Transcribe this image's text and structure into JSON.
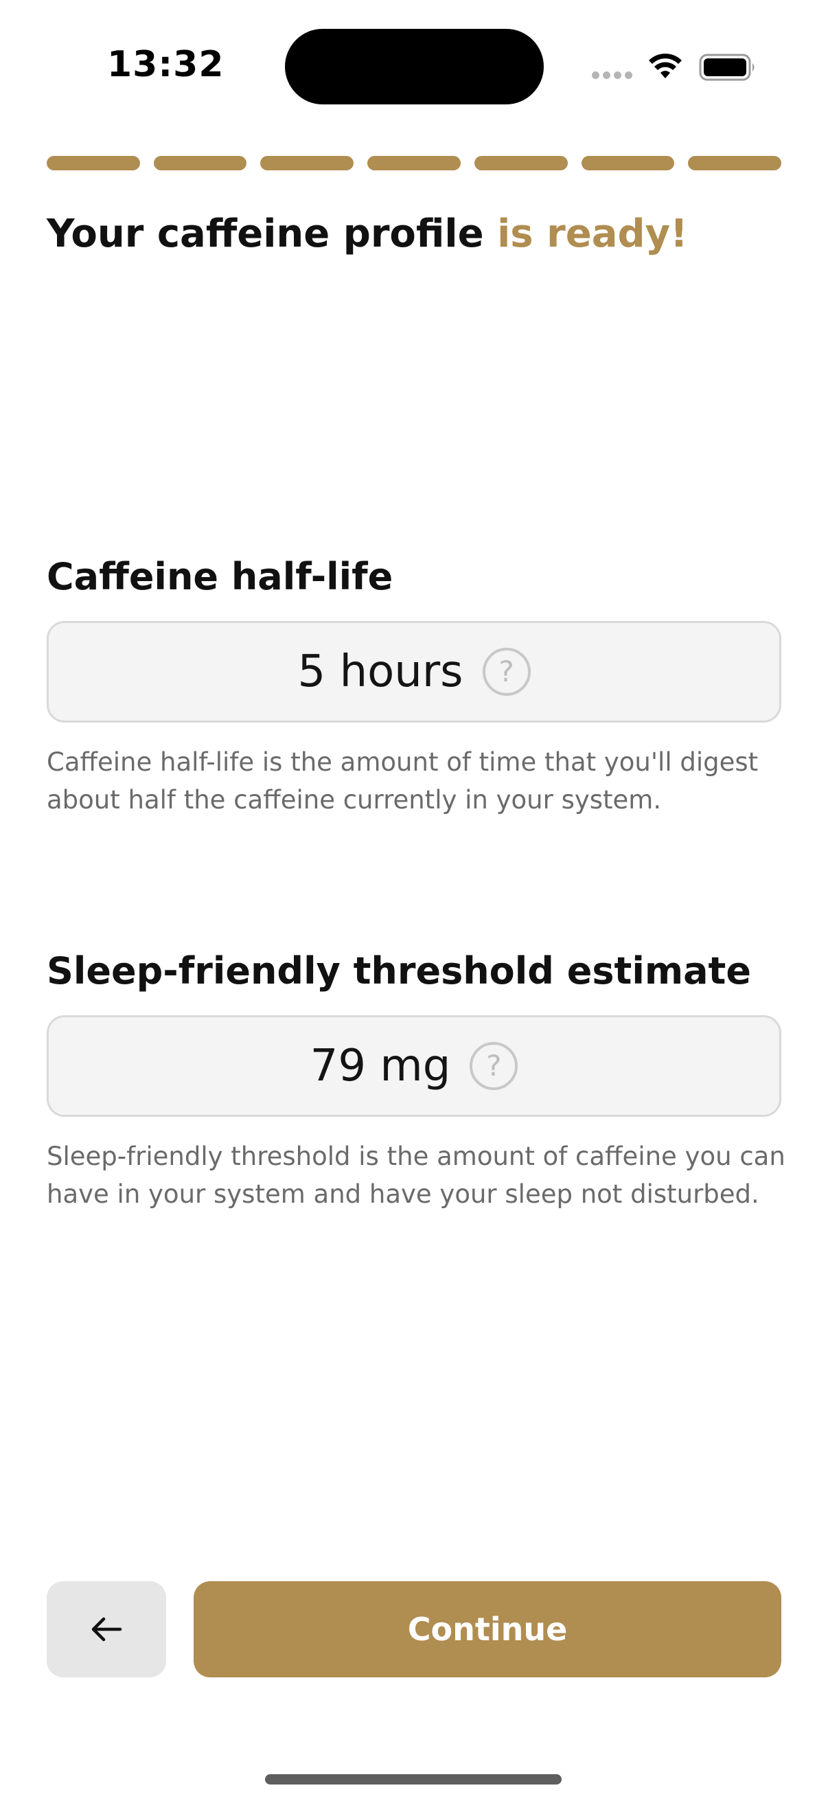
{
  "status_bar": {
    "time": "13:32",
    "icons": [
      "cellular-signal-icon",
      "wifi-icon",
      "battery-icon"
    ]
  },
  "progress": {
    "total_steps": 7,
    "completed_steps": 7,
    "color": "#b08d50"
  },
  "title": {
    "main": "Your caffeine profile ",
    "accent": "is ready!"
  },
  "half_life": {
    "heading": "Caffeine half-life",
    "value": "5 hours",
    "help_symbol": "?",
    "description": "Caffeine half-life is the amount of time that you'll digest about half the caffeine currently in your system."
  },
  "threshold": {
    "heading": "Sleep-friendly threshold estimate",
    "value": "79 mg",
    "help_symbol": "?",
    "description": "Sleep-friendly threshold is the amount of caffeine you can have in your system and have your sleep not disturbed."
  },
  "actions": {
    "back_icon": "arrow-left-icon",
    "continue_label": "Continue"
  },
  "colors": {
    "accent": "#b08d50",
    "box_background": "#f4f4f4",
    "back_button_background": "#e6e6e6"
  }
}
